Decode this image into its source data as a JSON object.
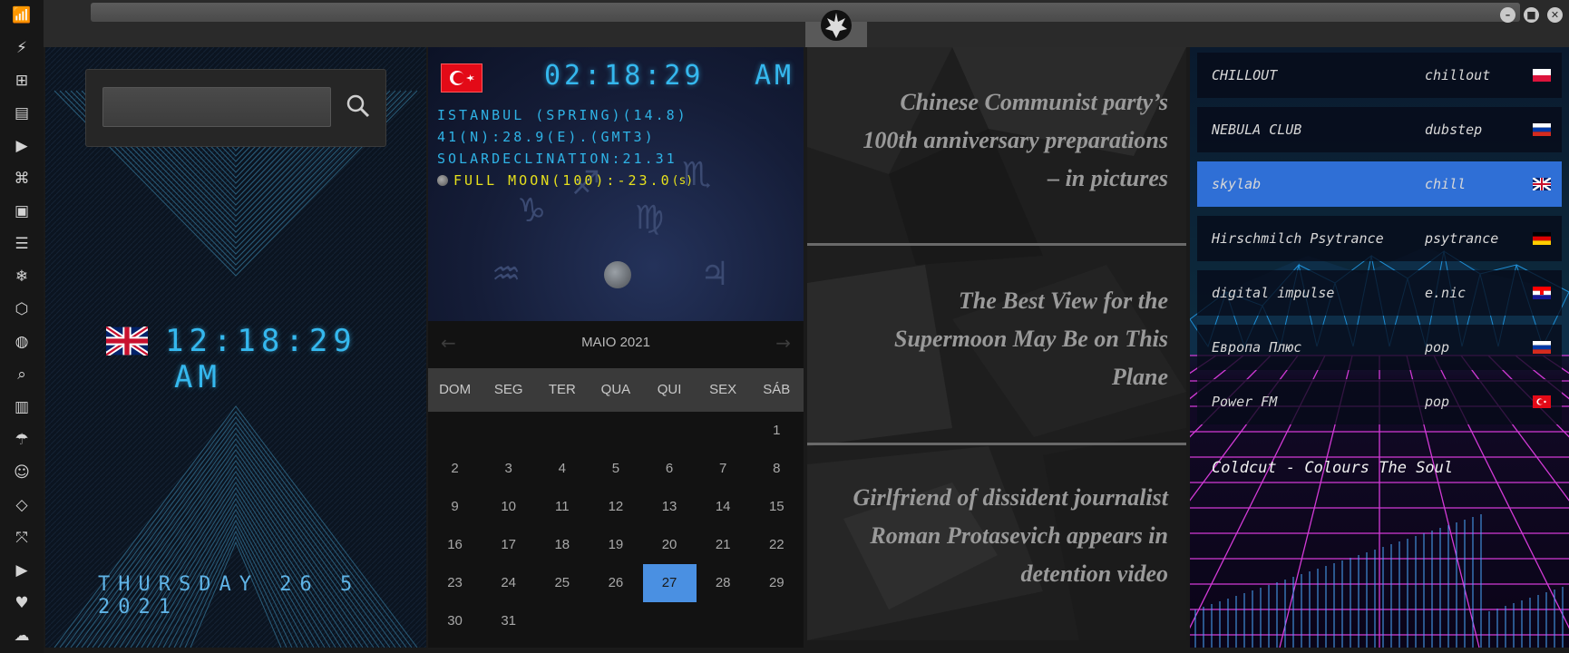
{
  "sidebar": {
    "icons": [
      "wifi-icon",
      "bolt-icon",
      "windows-icon",
      "archive-icon",
      "play-icon",
      "map-book-icon",
      "image-icon",
      "news-icon",
      "snowflake-icon",
      "hexagon-icon",
      "globe-icon",
      "search-icon",
      "map-icon",
      "umbrella-icon",
      "contacts-icon",
      "code-icon",
      "fullscreen-icon",
      "youtube-icon",
      "heart-icon",
      "cloud-icon"
    ]
  },
  "window": {
    "logo": "rebel-alliance-icon",
    "controls": [
      "minimize-icon",
      "maximize-icon",
      "close-icon"
    ]
  },
  "clock": {
    "search_value": "",
    "flag": "uk",
    "time": "12:18:29",
    "ampm": "AM",
    "date": "THURSDAY 26 5 2021"
  },
  "city": {
    "flag": "turkey",
    "time": "02:18:29",
    "ampm": "AM",
    "line1": "ISTANBUL (SPRING)(14.8)",
    "line2": "41(N):28.9(E).(GMT3)",
    "line3": "SOLARDECLINATION:21.31",
    "moon": "FULL MOON(100):-23.0",
    "moon_suffix": "(s)"
  },
  "calendar": {
    "month": "MAIO 2021",
    "weekdays": [
      "DOM",
      "SEG",
      "TER",
      "QUA",
      "QUI",
      "SEX",
      "SÁB"
    ],
    "weeks": [
      [
        "",
        "",
        "",
        "",
        "",
        "",
        "1"
      ],
      [
        "2",
        "3",
        "4",
        "5",
        "6",
        "7",
        "8"
      ],
      [
        "9",
        "10",
        "11",
        "12",
        "13",
        "14",
        "15"
      ],
      [
        "16",
        "17",
        "18",
        "19",
        "20",
        "21",
        "22"
      ],
      [
        "23",
        "24",
        "25",
        "26",
        "27",
        "28",
        "29"
      ],
      [
        "30",
        "31",
        "",
        "",
        "",
        "",
        ""
      ]
    ],
    "today": "27",
    "accent": "#4a90e2"
  },
  "news": [
    {
      "title": "Chinese Communist party’s 100th anniversary preparations – in pictures",
      "lines": [
        "Chinese Communist party’s",
        "100th anniversary preparations",
        "– in pictures"
      ]
    },
    {
      "title": "The Best View for the Supermoon May Be on This Plane",
      "lines": [
        "The Best View for the",
        "Supermoon May Be on This",
        "Plane"
      ]
    },
    {
      "title": "Girlfriend of dissident journalist Roman Protasevich appears in detention video",
      "lines": [
        "Girlfriend of dissident journalist",
        "Roman Protasevich appears in",
        "detention video"
      ]
    }
  ],
  "radio": {
    "stations": [
      {
        "name": "CHILLOUT",
        "genre": "chillout",
        "flag": "poland",
        "selected": false
      },
      {
        "name": "NEBULA CLUB",
        "genre": "dubstep",
        "flag": "russia",
        "selected": false
      },
      {
        "name": "skylab",
        "genre": "chill",
        "flag": "uk",
        "selected": true
      },
      {
        "name": "Hirschmilch Psytrance",
        "genre": "psytrance",
        "flag": "germany",
        "selected": false
      },
      {
        "name": "digital impulse",
        "genre": "e.nic",
        "flag": "croatia",
        "selected": false
      },
      {
        "name": "Европа Плюс",
        "genre": "pop",
        "flag": "russia",
        "selected": false
      },
      {
        "name": "Power FM",
        "genre": "pop",
        "flag": "turkey",
        "selected": false
      }
    ],
    "now_playing": "Coldcut - Colours The Soul"
  }
}
